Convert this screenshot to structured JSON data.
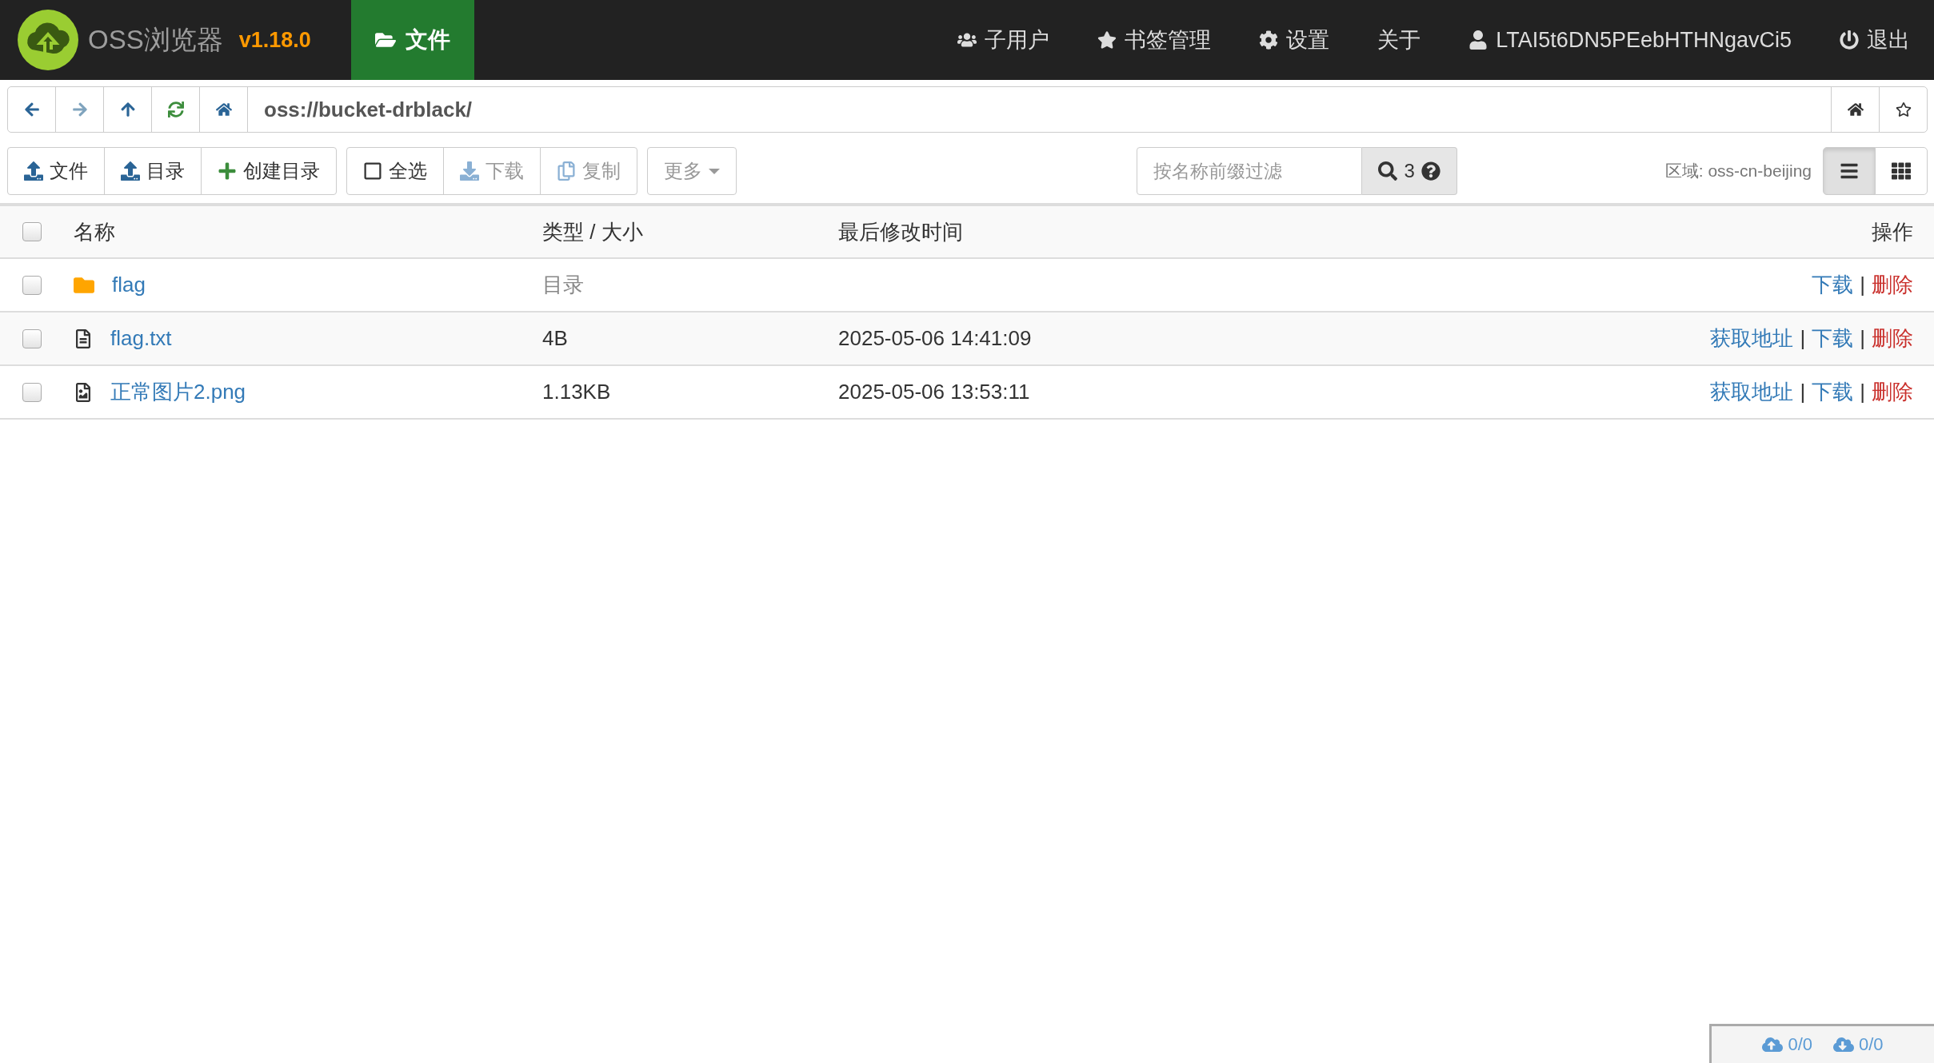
{
  "app": {
    "name": "OSS浏览器",
    "version": "v1.18.0"
  },
  "main_tab": {
    "label": "文件",
    "selected": true
  },
  "nav": [
    {
      "label": "子用户"
    },
    {
      "label": "书签管理"
    },
    {
      "label": "设置"
    },
    {
      "label": "关于"
    },
    {
      "label": "LTAI5t6DN5PEebHTHNgavCi5"
    },
    {
      "label": "退出"
    }
  ],
  "address_bar": {
    "nav_buttons": [
      {
        "disabled": false
      },
      {
        "disabled": true
      },
      {
        "disabled": false
      },
      {
        "disabled": false
      },
      {
        "disabled": false
      }
    ],
    "path": "oss://bucket-drblack/"
  },
  "toolbar": {
    "upload_buttons": [
      {
        "label": "文件",
        "disabled": false
      },
      {
        "label": "目录",
        "disabled": false
      },
      {
        "label": "创建目录",
        "disabled": false
      }
    ],
    "select_all": {
      "label": "全选",
      "checked": false
    },
    "file_buttons": [
      {
        "label": "下载",
        "disabled": true
      },
      {
        "label": "复制",
        "disabled": true
      }
    ],
    "more": {
      "label": "更多"
    },
    "filter": {
      "placeholder": "按名称前缀过滤"
    },
    "count": "3",
    "region": "区域: oss-cn-beijing",
    "view_modes": [
      {
        "selected": true
      },
      {
        "selected": false
      }
    ]
  },
  "table": {
    "select_all_checked": false,
    "columns": [
      "名称",
      "类型 / 大小",
      "最后修改时间",
      "操作"
    ],
    "rows": [
      {
        "kind": "folder",
        "name": "flag",
        "type_size": "目录",
        "checked": false,
        "actions": [
          {
            "label": "下载",
            "kind": "link"
          },
          {
            "label": "|",
            "kind": "separator"
          },
          {
            "label": "删除",
            "kind": "danger"
          }
        ]
      },
      {
        "kind": "text",
        "name": "flag.txt",
        "type_size": "4B",
        "modified": "2025-05-06 14:41:09",
        "checked": false,
        "actions": [
          {
            "label": "获取地址",
            "kind": "link"
          },
          {
            "label": "|",
            "kind": "separator"
          },
          {
            "label": "下载",
            "kind": "link"
          },
          {
            "label": "|",
            "kind": "separator"
          },
          {
            "label": "删除",
            "kind": "danger"
          }
        ]
      },
      {
        "kind": "image",
        "name": "正常图片2.png",
        "type_size": "1.13KB",
        "modified": "2025-05-06 13:53:11",
        "checked": false,
        "actions": [
          {
            "label": "获取地址",
            "kind": "link"
          },
          {
            "label": "|",
            "kind": "separator"
          },
          {
            "label": "下载",
            "kind": "link"
          },
          {
            "label": "|",
            "kind": "separator"
          },
          {
            "label": "删除",
            "kind": "danger"
          }
        ]
      }
    ]
  },
  "transfers": {
    "upload": "0/0",
    "download": "0/0"
  }
}
